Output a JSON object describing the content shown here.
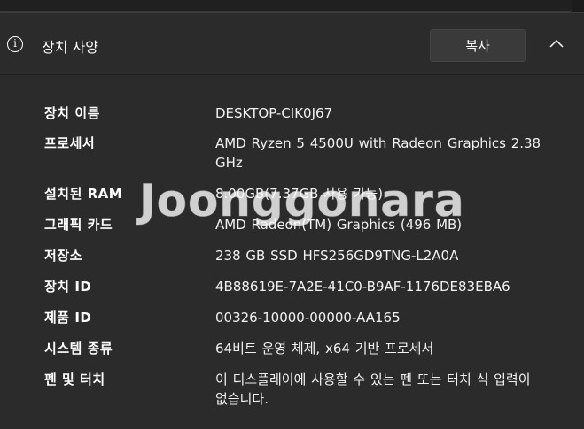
{
  "header": {
    "title": "장치 사양",
    "copy_label": "복사"
  },
  "specs": [
    {
      "label": "장치 이름",
      "value": "DESKTOP-CIK0J67"
    },
    {
      "label": "프로세서",
      "value": "AMD Ryzen 5 4500U with Radeon Graphics 2.38 GHz"
    },
    {
      "label": "설치된 RAM",
      "value": "8.00GB(7.37GB 사용 가능)"
    },
    {
      "label": "그래픽 카드",
      "value": "AMD Radeon(TM) Graphics (496 MB)"
    },
    {
      "label": "저장소",
      "value": "238 GB SSD HFS256GD9TNG-L2A0A"
    },
    {
      "label": "장치 ID",
      "value": "4B88619E-7A2E-41C0-B9AF-1176DE83EBA6"
    },
    {
      "label": "제품 ID",
      "value": "00326-10000-00000-AA165"
    },
    {
      "label": "시스템 종류",
      "value": "64비트 운영 체제, x64 기반 프로세서"
    },
    {
      "label": "펜 및 터치",
      "value": "이 디스플레이에 사용할 수 있는 펜 또는 터치 식 입력이 없습니다."
    }
  ],
  "watermark": "Joonggonara"
}
